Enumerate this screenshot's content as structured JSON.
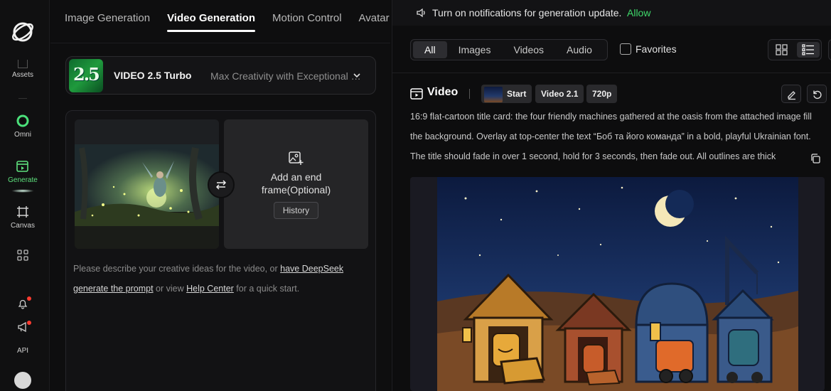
{
  "rail": {
    "items": [
      {
        "label": "Assets"
      },
      {
        "label": "Omni"
      },
      {
        "label": "Generate"
      },
      {
        "label": "Canvas"
      },
      {
        "label": "API"
      }
    ]
  },
  "tabs": [
    "Image Generation",
    "Video Generation",
    "Motion Control",
    "Avatar"
  ],
  "model": {
    "badge": "2.5",
    "name": "VIDEO 2.5 Turbo",
    "description": "Max Creativity with Exceptional Value"
  },
  "frames": {
    "end_frame_label": "Add an end frame(Optional)",
    "history_label": "History"
  },
  "prompt_hint": {
    "before": "Please describe your creative ideas for the video, or ",
    "link1": "have DeepSeek generate the prompt",
    "middle": " or view ",
    "link2": "Help Center",
    "after": " for a quick start."
  },
  "notification": {
    "text": "Turn on notifications for generation update.",
    "action": "Allow"
  },
  "filters": [
    "All",
    "Images",
    "Videos",
    "Audio"
  ],
  "favorites_label": "Favorites",
  "card": {
    "type_label": "Video",
    "start_chip": "Start",
    "model_chip": "Video 2.1",
    "resolution_chip": "720p",
    "description": "16:9 flat-cartoon title card: the four friendly machines gathered at the oasis from the attached image fill the background. Overlay at top-center the text “Боб та його команда” in a bold, playful Ukrainian font. The title should fade in over 1 second, hold for 3 seconds, then fade out. All outlines are thick"
  },
  "colors": {
    "accent_green": "#3fd96b",
    "notification_dot": "#ff3b30"
  }
}
